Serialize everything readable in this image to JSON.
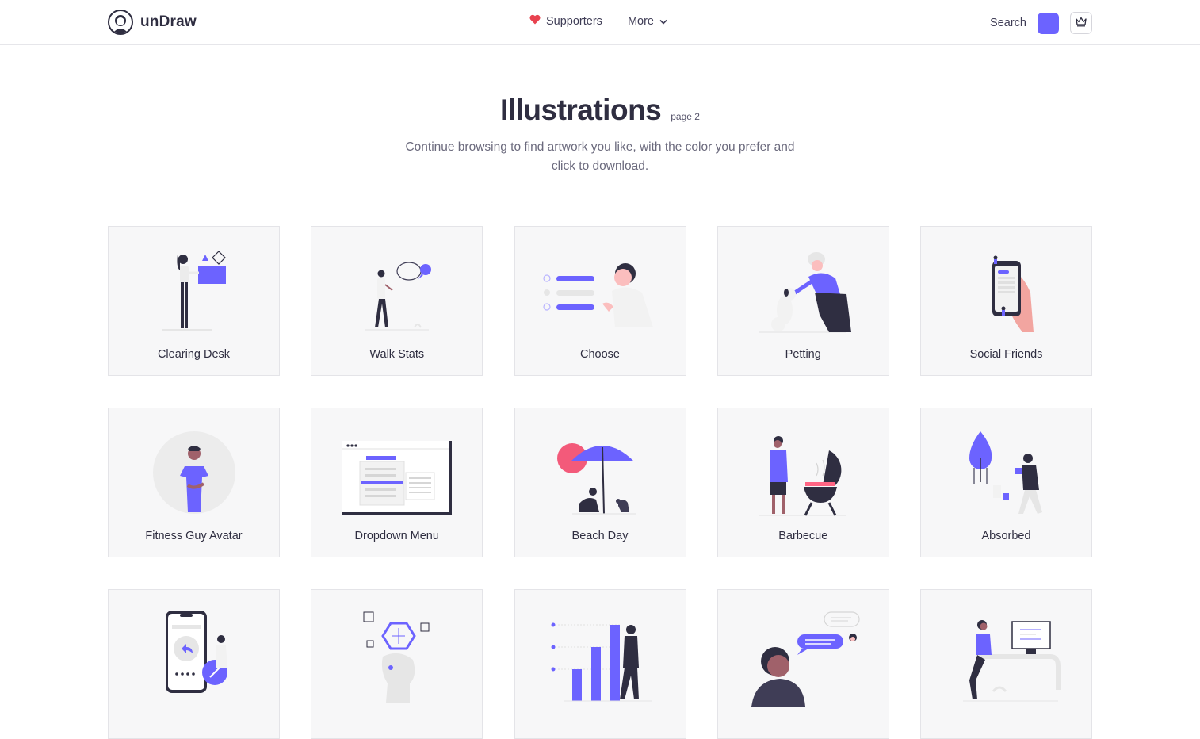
{
  "brand": {
    "name": "unDraw"
  },
  "nav": {
    "supporters": "Supporters",
    "more": "More"
  },
  "toolbar": {
    "search_label": "Search",
    "accent_color": "#6c63ff"
  },
  "hero": {
    "title": "Illustrations",
    "page_label": "page 2",
    "subtitle": "Continue browsing to find artwork you like, with the color you prefer and click to download."
  },
  "illustrations": [
    {
      "title": "Clearing Desk",
      "icon": "clearing-desk-illustration"
    },
    {
      "title": "Walk Stats",
      "icon": "walk-stats-illustration"
    },
    {
      "title": "Choose",
      "icon": "choose-illustration"
    },
    {
      "title": "Petting",
      "icon": "petting-illustration"
    },
    {
      "title": "Social Friends",
      "icon": "social-friends-illustration"
    },
    {
      "title": "Fitness Guy Avatar",
      "icon": "fitness-guy-avatar-illustration"
    },
    {
      "title": "Dropdown Menu",
      "icon": "dropdown-menu-illustration"
    },
    {
      "title": "Beach Day",
      "icon": "beach-day-illustration"
    },
    {
      "title": "Barbecue",
      "icon": "barbecue-illustration"
    },
    {
      "title": "Absorbed",
      "icon": "absorbed-illustration"
    },
    {
      "title": "",
      "icon": "phone-link-illustration"
    },
    {
      "title": "",
      "icon": "mind-network-illustration"
    },
    {
      "title": "",
      "icon": "growth-chart-illustration"
    },
    {
      "title": "",
      "icon": "chat-bubble-illustration"
    },
    {
      "title": "",
      "icon": "desk-monitor-illustration"
    }
  ]
}
